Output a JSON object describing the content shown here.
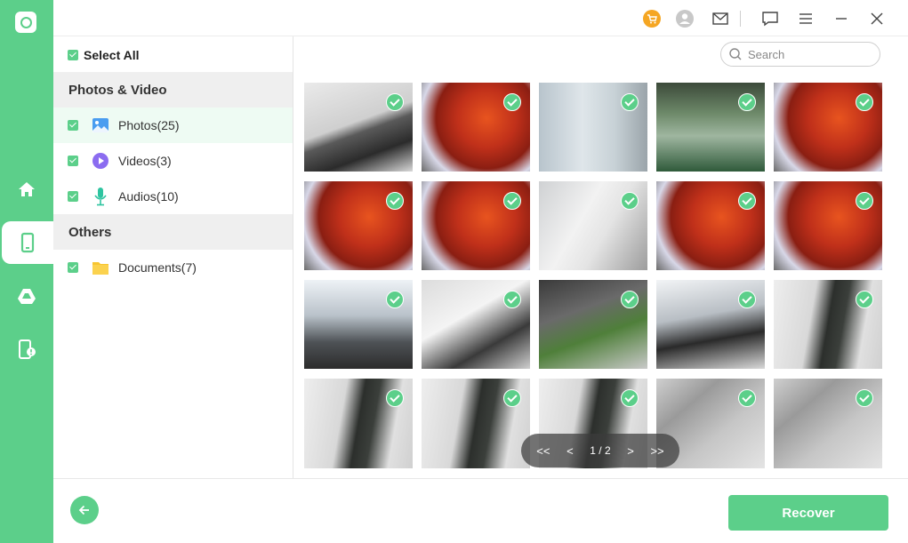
{
  "sidebar": {
    "items": [
      {
        "icon": "home-icon"
      },
      {
        "icon": "phone-icon",
        "active": true
      },
      {
        "icon": "google-drive-icon"
      },
      {
        "icon": "phone-alert-icon"
      }
    ]
  },
  "topbar": {
    "icons": [
      "cart-icon",
      "user-icon",
      "mail-icon",
      "feedback-icon",
      "menu-icon",
      "minimize-icon",
      "close-icon"
    ]
  },
  "categories": {
    "select_all": "Select All",
    "groups": [
      {
        "title": "Photos & Video",
        "items": [
          {
            "label": "Photos(25)",
            "icon": "photo-icon"
          },
          {
            "label": "Videos(3)",
            "icon": "video-icon"
          },
          {
            "label": "Audios(10)",
            "icon": "microphone-icon"
          }
        ]
      },
      {
        "title": "Others",
        "items": [
          {
            "label": "Documents(7)",
            "icon": "folder-icon"
          }
        ]
      }
    ]
  },
  "search": {
    "placeholder": "Search"
  },
  "gallery": {
    "thumbnails": [
      "t-desk",
      "t-chips",
      "t-phone",
      "t-poster",
      "t-chips",
      "t-chips",
      "t-chips",
      "t-mac",
      "t-chips",
      "t-chips",
      "t-office",
      "t-monitor",
      "t-plant",
      "t-mouse",
      "t-kbd",
      "t-kbd",
      "t-kbd",
      "t-kbd",
      "t-pen",
      "t-pen"
    ]
  },
  "pager": {
    "first": "<<",
    "prev": "<",
    "page": "1 / 2",
    "next": ">",
    "last": ">>"
  },
  "footer": {
    "recover_label": "Recover"
  },
  "colors": {
    "accent": "#5ccf8a"
  }
}
